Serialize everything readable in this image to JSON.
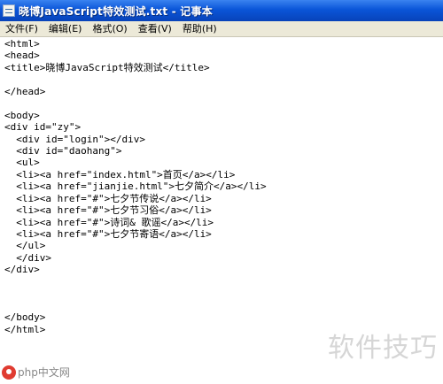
{
  "window": {
    "title": "晓博JavaScript特效测试.txt - 记事本",
    "icon": "notepad-icon"
  },
  "menu": [
    "文件(F)",
    "编辑(E)",
    "格式(O)",
    "查看(V)",
    "帮助(H)"
  ],
  "editor": {
    "lines": [
      "<html>",
      "<head>",
      "<title>晓博JavaScript特效测试</title>",
      "",
      "</head>",
      "",
      "<body>",
      "<div id=\"zy\">",
      "  <div id=\"login\"></div>",
      "  <div id=\"daohang\">",
      "  <ul>",
      "  <li><a href=\"index.html\">首页</a></li>",
      "  <li><a href=\"jianjie.html\">七夕简介</a></li>",
      "  <li><a href=\"#\">七夕节传说</a></li>",
      "  <li><a href=\"#\">七夕节习俗</a></li>",
      "  <li><a href=\"#\">诗词& 歌谣</a></li>",
      "  <li><a href=\"#\">七夕节寄语</a></li>",
      "  </ul>",
      "  </div>",
      "</div>",
      "",
      "",
      "",
      "</body>",
      "</html>"
    ]
  },
  "watermark": {
    "text": "软件技巧",
    "site": "php中文网"
  },
  "colors": {
    "titlebar": "#0a55d8",
    "menubar": "#ece9d8",
    "logo": "#e03c31"
  }
}
